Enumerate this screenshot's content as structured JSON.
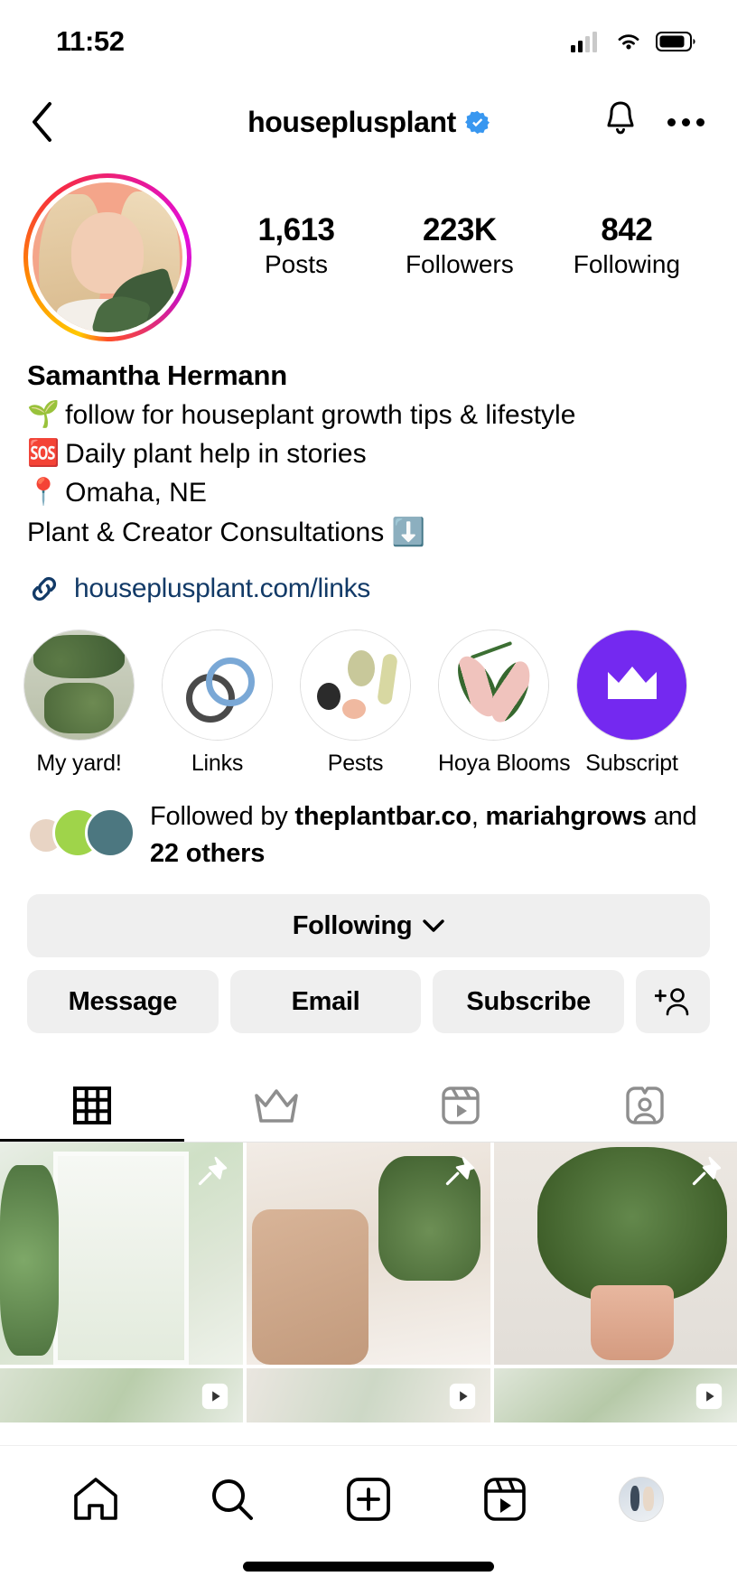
{
  "status_bar": {
    "time": "11:52",
    "cellular_icon": "cellular-signal-icon",
    "wifi_icon": "wifi-icon",
    "battery_icon": "battery-icon"
  },
  "header": {
    "back_icon": "back-chevron-icon",
    "username": "houseplusplant",
    "verified_icon": "verified-badge-icon",
    "bell_icon": "notification-bell-icon",
    "more_icon": "more-options-icon"
  },
  "profile": {
    "avatar_name": "profile-avatar",
    "has_story_ring": true,
    "stats": [
      {
        "value": "1,613",
        "label": "Posts"
      },
      {
        "value": "223K",
        "label": "Followers"
      },
      {
        "value": "842",
        "label": "Following"
      }
    ],
    "display_name": "Samantha Hermann",
    "bio_lines": [
      {
        "emoji": "🌱",
        "emoji_name": "seedling-emoji",
        "text": "follow for houseplant growth tips & lifestyle"
      },
      {
        "emoji": "🆘",
        "emoji_name": "sos-emoji",
        "text": "Daily plant help in stories"
      },
      {
        "emoji": "📍",
        "emoji_name": "pin-emoji",
        "text": "Omaha, NE"
      },
      {
        "emoji": "",
        "emoji_name": "",
        "text": "Plant & Creator Consultations ⬇️"
      }
    ],
    "link": {
      "icon": "link-chain-icon",
      "text": "houseplusplant.com/links",
      "color": "#123a67"
    }
  },
  "highlights": [
    {
      "label": "My yard!",
      "icon": "highlight-cover-yard"
    },
    {
      "label": "Links",
      "icon": "highlight-cover-links"
    },
    {
      "label": "Pests",
      "icon": "highlight-cover-pests"
    },
    {
      "label": "Hoya Blooms",
      "icon": "highlight-cover-hoya"
    },
    {
      "label": "Subscript",
      "icon": "highlight-cover-subscriptions"
    }
  ],
  "followed_by": {
    "prefix": "Followed by ",
    "name_1": "theplantbar.co",
    "separator": ", ",
    "name_2": "mariahgrows",
    "conjunction": " and ",
    "others": "22 others",
    "avatar_count": 3
  },
  "action_buttons": {
    "following_label": "Following",
    "following_chevron": "chevron-down-icon",
    "message_label": "Message",
    "email_label": "Email",
    "subscribe_label": "Subscribe",
    "add_user_icon": "add-user-icon"
  },
  "content_tabs": [
    {
      "name": "grid-tab",
      "icon": "grid-icon",
      "active": true
    },
    {
      "name": "subscriptions-tab",
      "icon": "crown-icon",
      "active": false
    },
    {
      "name": "reels-tab",
      "icon": "reels-icon",
      "active": false
    },
    {
      "name": "tagged-tab",
      "icon": "tagged-person-icon",
      "active": false
    }
  ],
  "grid_posts": [
    {
      "style": "p1",
      "pinned": true,
      "is_reel": false
    },
    {
      "style": "p2",
      "pinned": true,
      "is_reel": false
    },
    {
      "style": "p3",
      "pinned": true,
      "is_reel": false
    },
    {
      "style": "p4",
      "pinned": false,
      "is_reel": true
    },
    {
      "style": "p5",
      "pinned": false,
      "is_reel": true
    },
    {
      "style": "p6",
      "pinned": false,
      "is_reel": true
    }
  ],
  "bottom_nav": [
    {
      "name": "nav-home",
      "icon": "home-icon"
    },
    {
      "name": "nav-search",
      "icon": "search-icon"
    },
    {
      "name": "nav-create",
      "icon": "plus-square-icon"
    },
    {
      "name": "nav-reels",
      "icon": "reels-icon"
    },
    {
      "name": "nav-profile",
      "icon": "profile-avatar-icon"
    }
  ],
  "colors": {
    "verified_blue": "#3897f0",
    "link_navy": "#123a67",
    "button_gray": "#efefef",
    "subscription_purple": "#7429f0"
  }
}
